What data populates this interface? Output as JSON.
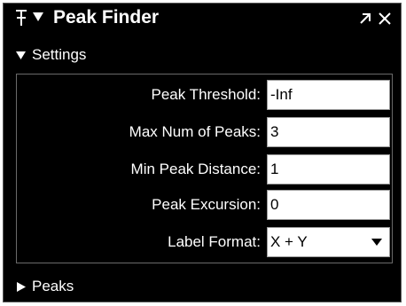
{
  "window": {
    "title": "Peak Finder"
  },
  "settings": {
    "header_label": "Settings",
    "fields": [
      {
        "label": "Peak Threshold:",
        "value": "-Inf"
      },
      {
        "label": "Max Num of Peaks:",
        "value": "3"
      },
      {
        "label": "Min Peak Distance:",
        "value": "1"
      },
      {
        "label": "Peak Excursion:",
        "value": "0"
      }
    ],
    "label_format": {
      "label": "Label Format:",
      "selected": "X + Y"
    }
  },
  "peaks": {
    "header_label": "Peaks"
  },
  "icons": {
    "pin": "pin-icon",
    "collapse": "triangle-down-icon",
    "undock": "arrow-up-right-icon",
    "close": "close-icon",
    "expand": "triangle-right-icon"
  },
  "colors": {
    "panel_bg": "#000000",
    "text": "#ffffff",
    "field_bg": "#ffffff"
  }
}
